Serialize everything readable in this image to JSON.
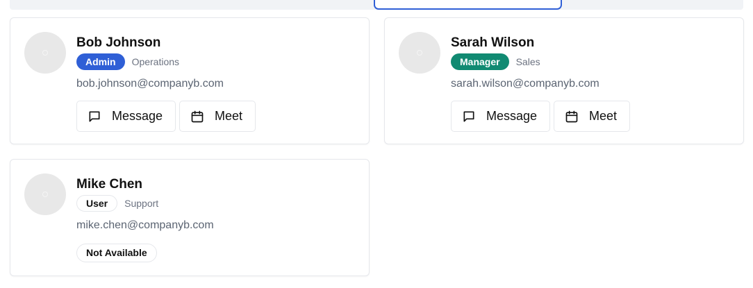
{
  "users": [
    {
      "name": "Bob Johnson",
      "role": "Admin",
      "role_color": "#2f5fd6",
      "department": "Operations",
      "email": "bob.johnson@companyb.com",
      "actions": {
        "message_label": "Message",
        "meet_label": "Meet"
      }
    },
    {
      "name": "Sarah Wilson",
      "role": "Manager",
      "role_color": "#118a72",
      "department": "Sales",
      "email": "sarah.wilson@companyb.com",
      "actions": {
        "message_label": "Message",
        "meet_label": "Meet"
      }
    },
    {
      "name": "Mike Chen",
      "role": "User",
      "department": "Support",
      "email": "mike.chen@companyb.com",
      "status": "Not Available"
    }
  ],
  "icons": {
    "message": "message-square-icon",
    "meet": "calendar-icon",
    "avatar": "avatar-placeholder"
  }
}
